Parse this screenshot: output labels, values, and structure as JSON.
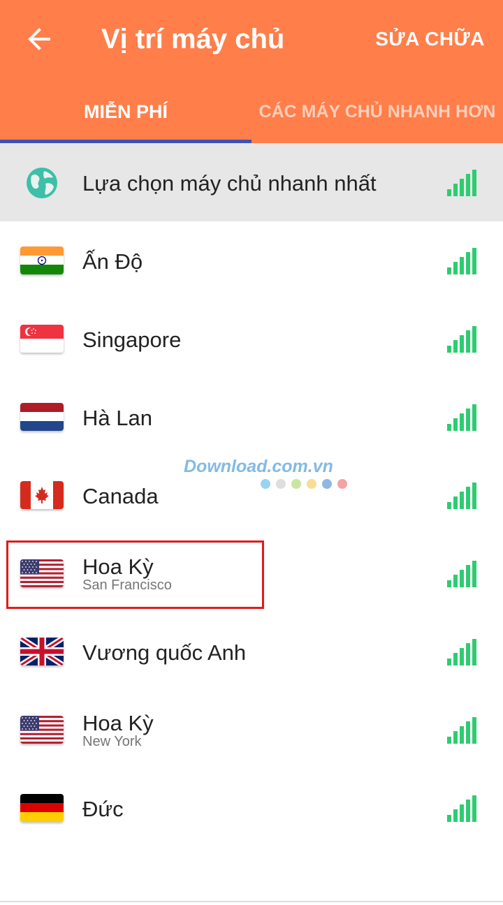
{
  "header": {
    "title": "Vị trí máy chủ",
    "edit_label": "SỬA CHỮA"
  },
  "tabs": [
    {
      "label": "MIỄN PHÍ",
      "active": true
    },
    {
      "label": "CÁC MÁY CHỦ NHANH HƠN",
      "active": false
    }
  ],
  "servers": [
    {
      "name": "Lựa chọn máy chủ nhanh nhất",
      "subtitle": "",
      "icon": "globe-icon"
    },
    {
      "name": "Ấn Độ",
      "subtitle": "",
      "icon": "india-flag-icon"
    },
    {
      "name": "Singapore",
      "subtitle": "",
      "icon": "singapore-flag-icon"
    },
    {
      "name": "Hà Lan",
      "subtitle": "",
      "icon": "netherlands-flag-icon"
    },
    {
      "name": "Canada",
      "subtitle": "",
      "icon": "canada-flag-icon"
    },
    {
      "name": "Hoa Kỳ",
      "subtitle": "San Francisco",
      "icon": "usa-flag-icon"
    },
    {
      "name": "Vương quốc Anh",
      "subtitle": "",
      "icon": "uk-flag-icon"
    },
    {
      "name": "Hoa Kỳ",
      "subtitle": "New York",
      "icon": "usa-flag-icon"
    },
    {
      "name": "Đức",
      "subtitle": "",
      "icon": "germany-flag-icon"
    }
  ],
  "watermark": {
    "text": "Download.com.vn"
  },
  "colors": {
    "accent": "#FF7E4A",
    "tab_indicator": "#3F51B5",
    "signal": "#2ECC71",
    "highlight": "#E01B1B"
  }
}
